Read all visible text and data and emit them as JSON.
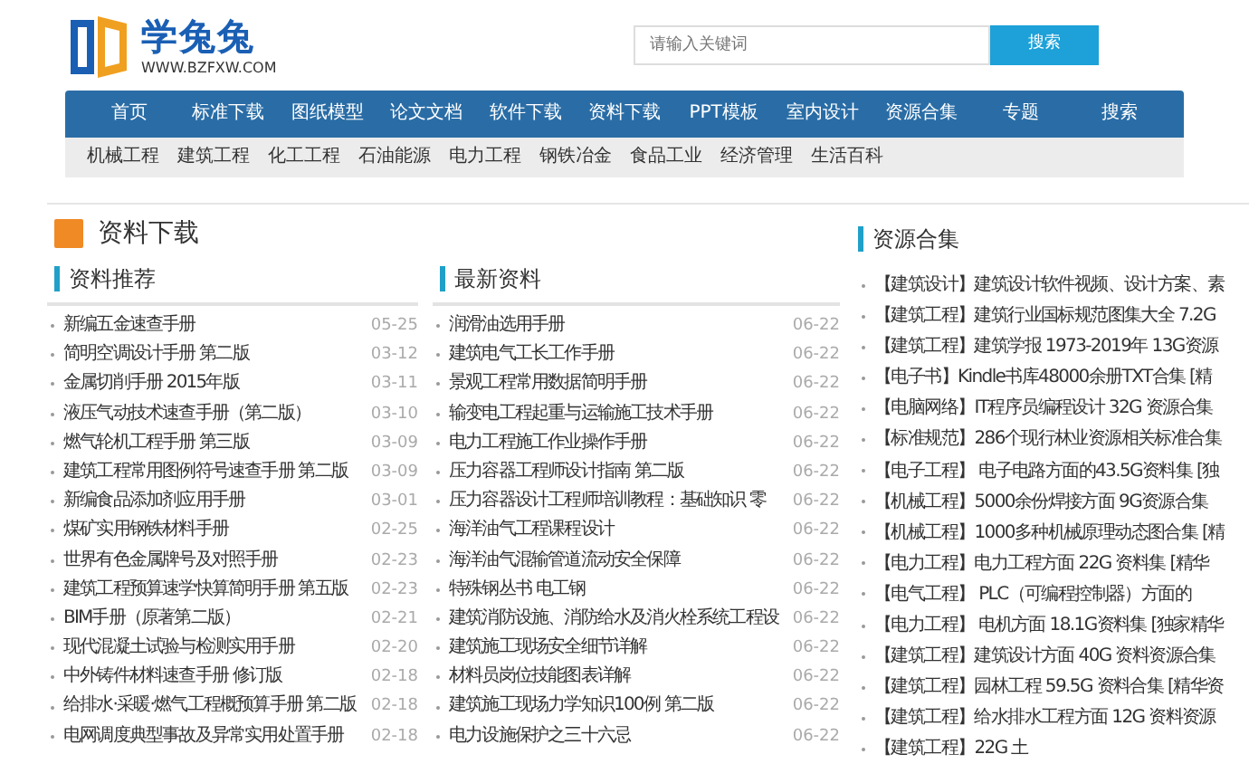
{
  "logo": {
    "name": "学兔兔",
    "url": "WWW.BZFXW.COM"
  },
  "search": {
    "placeholder": "请输入关键词",
    "button": "搜索"
  },
  "nav": [
    "首页",
    "标准下载",
    "图纸模型",
    "论文文档",
    "软件下载",
    "资料下载",
    "PPT模板",
    "室内设计",
    "资源合集",
    "专题",
    "搜索"
  ],
  "subnav": [
    "机械工程",
    "建筑工程",
    "化工工程",
    "石油能源",
    "电力工程",
    "钢铁冶金",
    "食品工业",
    "经济管理",
    "生活百科"
  ],
  "section_title": "资料下载",
  "columns": [
    {
      "title": "资料推荐",
      "items": [
        {
          "title": "新编五金速查手册",
          "date": "05-25"
        },
        {
          "title": "简明空调设计手册 第二版",
          "date": "03-12"
        },
        {
          "title": "金属切削手册 2015年版",
          "date": "03-11"
        },
        {
          "title": "液压气动技术速查手册（第二版）",
          "date": "03-10"
        },
        {
          "title": "燃气轮机工程手册 第三版",
          "date": "03-09"
        },
        {
          "title": "建筑工程常用图例符号速查手册 第二版",
          "date": "03-09"
        },
        {
          "title": "新编食品添加剂应用手册",
          "date": "03-01"
        },
        {
          "title": "煤矿实用钢铁材料手册",
          "date": "02-25"
        },
        {
          "title": "世界有色金属牌号及对照手册",
          "date": "02-23"
        },
        {
          "title": "建筑工程预算速学快算简明手册 第五版",
          "date": "02-23"
        },
        {
          "title": "BIM手册（原著第二版）",
          "date": "02-21"
        },
        {
          "title": "现代混凝土试验与检测实用手册",
          "date": "02-20"
        },
        {
          "title": "中外铸件材料速查手册 修订版",
          "date": "02-18"
        },
        {
          "title": "给排水·采暖·燃气工程概预算手册 第二版",
          "date": "02-18"
        },
        {
          "title": "电网调度典型事故及异常实用处置手册",
          "date": "02-18"
        }
      ]
    },
    {
      "title": "最新资料",
      "items": [
        {
          "title": "润滑油选用手册",
          "date": "06-22"
        },
        {
          "title": "建筑电气工长工作手册",
          "date": "06-22"
        },
        {
          "title": "景观工程常用数据简明手册",
          "date": "06-22"
        },
        {
          "title": "输变电工程起重与运输施工技术手册",
          "date": "06-22"
        },
        {
          "title": "电力工程施工作业操作手册",
          "date": "06-22"
        },
        {
          "title": "压力容器工程师设计指南 第二版",
          "date": "06-22"
        },
        {
          "title": "压力容器设计工程师培训教程：基础知识 零",
          "date": "06-22"
        },
        {
          "title": "海洋油气工程课程设计",
          "date": "06-22"
        },
        {
          "title": "海洋油气混输管道流动安全保障",
          "date": "06-22"
        },
        {
          "title": "特殊钢丛书 电工钢",
          "date": "06-22"
        },
        {
          "title": "建筑消防设施、消防给水及消火栓系统工程设",
          "date": "06-22"
        },
        {
          "title": "建筑施工现场安全细节详解",
          "date": "06-22"
        },
        {
          "title": "材料员岗位技能图表详解",
          "date": "06-22"
        },
        {
          "title": "建筑施工现场力学知识100例 第二版",
          "date": "06-22"
        },
        {
          "title": "电力设施保护之三十六忌",
          "date": "06-22"
        }
      ]
    }
  ],
  "sidebar": {
    "title": "资源合集",
    "items": [
      "【建筑设计】建筑设计软件视频、设计方案、素",
      "【建筑工程】建筑行业国标规范图集大全 7.2G",
      "【建筑工程】建筑学报 1973-2019年 13G资源",
      "【电子书】Kindle书库48000余册TXT合集 [精",
      "【电脑网络】IT程序员编程设计 32G 资源合集",
      "【标准规范】286个现行林业资源相关标准合集",
      "【电子工程】 电子电路方面的43.5G资料集 [独",
      "【机械工程】5000余份焊接方面 9G资源合集",
      "【机械工程】1000多种机械原理动态图合集 [精",
      "【电力工程】电力工程方面 22G 资料集 [精华",
      "【电气工程】 PLC（可编程控制器）方面的",
      "【电力工程】 电机方面 18.1G资料集 [独家精华",
      "【建筑工程】建筑设计方面 40G 资料资源合集",
      "【建筑工程】园林工程 59.5G 资料合集 [精华资",
      "【建筑工程】给水排水工程方面 12G 资料资源",
      "【建筑工程】22G 土"
    ]
  }
}
